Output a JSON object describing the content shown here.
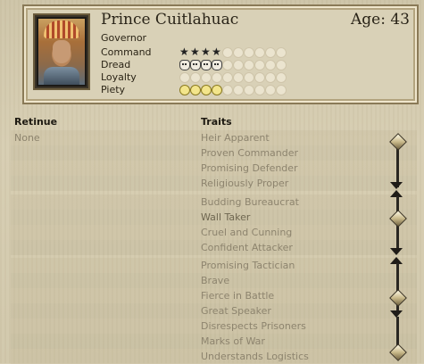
{
  "character": {
    "name": "Prince Cuitlahuac",
    "age_label": "Age: 43",
    "office": "Governor",
    "portrait_icon": "aztec-prince-portrait"
  },
  "attributes": [
    {
      "label": "Command",
      "value": 4,
      "max": 10,
      "icon": "star-icon"
    },
    {
      "label": "Dread",
      "value": 4,
      "max": 10,
      "icon": "skull-icon"
    },
    {
      "label": "Loyalty",
      "value": 0,
      "max": 10,
      "icon": "loyalty-icon"
    },
    {
      "label": "Piety",
      "value": 4,
      "max": 10,
      "icon": "halo-icon"
    }
  ],
  "retinue": {
    "header": "Retinue",
    "items": [
      "None"
    ]
  },
  "traits": {
    "header": "Traits",
    "items": [
      "Heir Apparent",
      "Proven Commander",
      "Promising Defender",
      "Religiously Proper",
      "Budding Bureaucrat",
      "Wall Taker",
      "Cruel and Cunning",
      "Confident Attacker",
      "Promising Tactician",
      "Brave",
      "Fierce in Battle",
      "Great Speaker",
      "Disrespects Prisoners",
      "Marks of War",
      "Understands Logistics"
    ]
  },
  "colors": {
    "parchment": "#d6cdb2",
    "trait_text": "#8d846e",
    "chain": "#2a2722"
  }
}
